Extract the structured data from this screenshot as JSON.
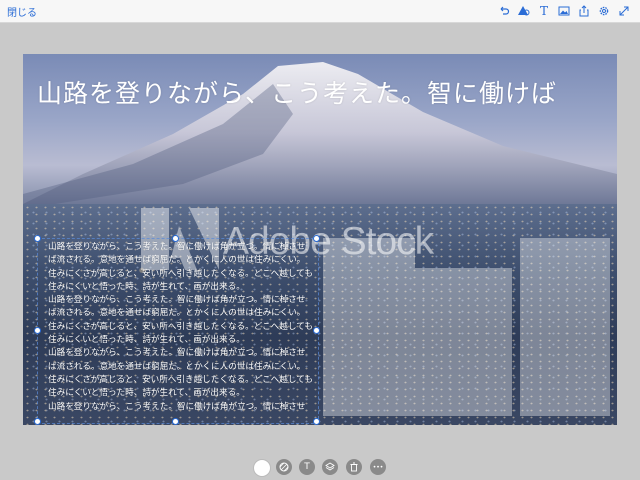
{
  "header": {
    "close_label": "閉じる",
    "icons": [
      "undo-icon",
      "shapes-icon",
      "text-icon",
      "image-icon",
      "share-icon",
      "settings-icon",
      "expand-icon"
    ],
    "text_icon_glyph": "T"
  },
  "canvas": {
    "headline": "山路を登りながら、こう考えた。智に働けば",
    "watermark": "Adobe Stock",
    "body_lines": [
      "山路を登りながら、こう考えた。智に働けば角が立つ。情に棹させ",
      "ば流される。意地を通せば窮屈だ。とかくに人の世は住みにくい。",
      "住みにくさが高じると、安い所へ引き越したくなる。どこへ越しても",
      "住みにくいと悟った時、詩が生れて、画が出来る。",
      "山路を登りながら、こう考えた。智に働けば角が立つ。情に棹させ",
      "ば流される。意地を通せば窮屈だ。とかくに人の世は住みにくい。",
      "住みにくさが高じると、安い所へ引き越したくなる。どこへ越しても",
      "住みにくいと悟った時、詩が生れて、画が出来る。",
      "山路を登りながら、こう考えた。智に働けば角が立つ。情に棹させ",
      "ば流される。意地を通せば窮屈だ。とかくに人の世は住みにくい。",
      "住みにくさが高じると、安い所へ引き越したくなる。どこへ越しても",
      "住みにくいと悟った時、詩が生れて、画が出来る。",
      "山路を登りながら、こう考えた。智に働けば角が立つ。情に棹させ"
    ]
  },
  "bottom_toolbar": {
    "items": [
      "color-swatch",
      "pattern-icon",
      "text-icon",
      "layers-icon",
      "delete-icon",
      "more-icon"
    ],
    "text_glyph": "T",
    "more_glyph": "•••"
  },
  "colors": {
    "accent": "#2a6cd6",
    "background": "#c9c9c9",
    "toolbar_button": "#8a8a8a"
  }
}
